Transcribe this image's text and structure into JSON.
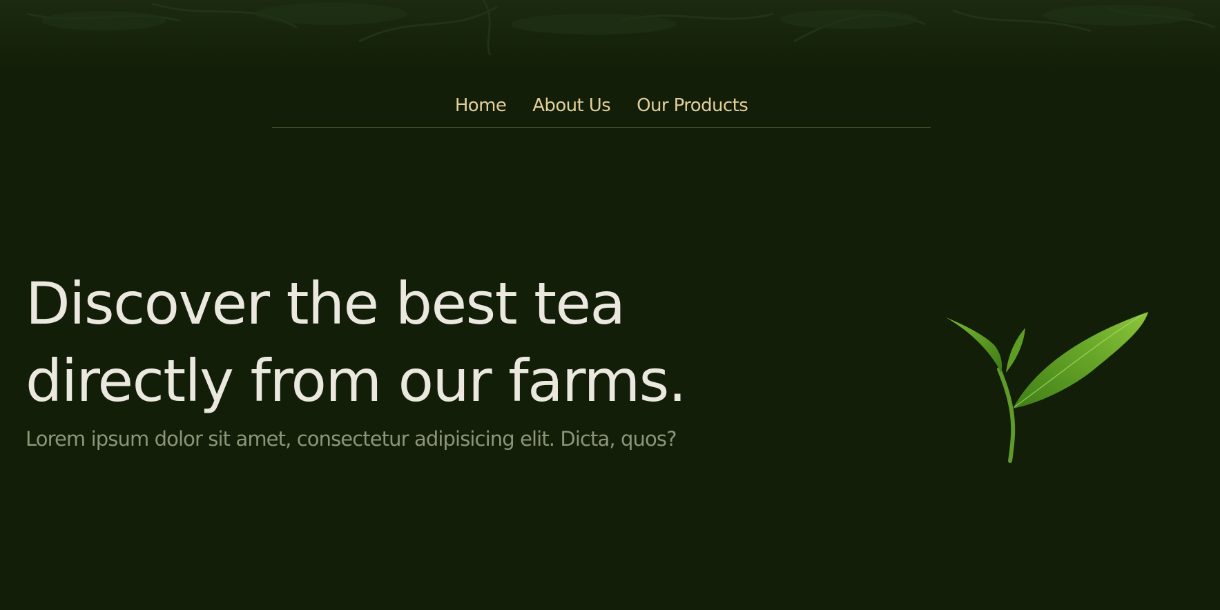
{
  "nav": {
    "items": [
      {
        "label": "Home"
      },
      {
        "label": "About Us"
      },
      {
        "label": "Our Products"
      }
    ]
  },
  "hero": {
    "title_line1": "Discover the best tea",
    "title_line2": "directly from our farms.",
    "subtitle": "Lorem ipsum dolor sit amet, consectetur adipisicing elit. Dicta, quos?"
  },
  "colors": {
    "background": "#121e07",
    "nav_text": "#e3cf9c",
    "title_text": "#ebe8df",
    "subtitle_text": "#8d957a",
    "leaf_green": "#6aa82a"
  },
  "icons": {
    "hero_image": "tea-leaf-icon",
    "top_background": "foliage-background"
  }
}
